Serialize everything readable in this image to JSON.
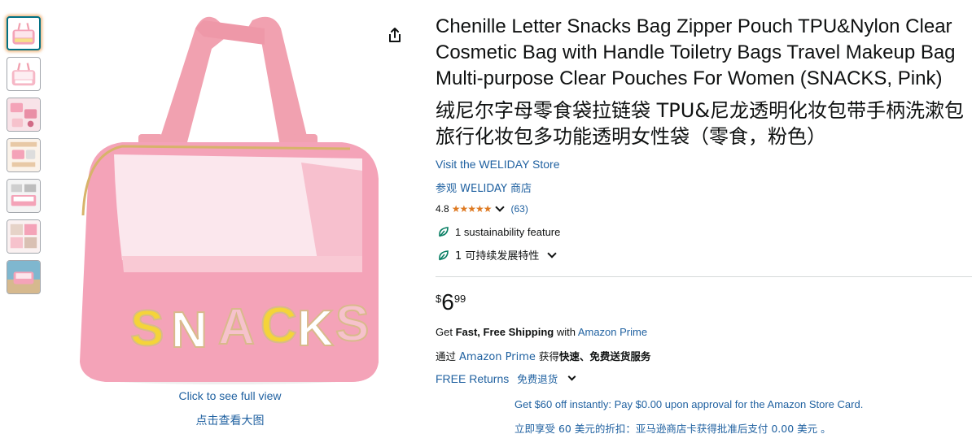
{
  "thumbnails": [
    {
      "name": "thumb-1",
      "selected": true
    },
    {
      "name": "thumb-2",
      "selected": false
    },
    {
      "name": "thumb-3",
      "selected": false
    },
    {
      "name": "thumb-4",
      "selected": false
    },
    {
      "name": "thumb-5",
      "selected": false
    },
    {
      "name": "thumb-6",
      "selected": false
    },
    {
      "name": "thumb-7",
      "selected": false
    }
  ],
  "image": {
    "bag_text": "SNACKS",
    "caption_en": "Click to see full view",
    "caption_zh": "点击查看大图"
  },
  "product": {
    "title_en": "Chenille Letter Snacks Bag Zipper Pouch TPU&Nylon Clear Cosmetic Bag with Handle Toiletry Bags Travel Makeup Bag Multi-purpose Clear Pouches For Women (SNACKS, Pink)",
    "title_zh": "绒尼尔字母零食袋拉链袋 TPU&尼龙透明化妆包带手柄洗漱包旅行化妆包多功能透明女性袋（零食，粉色）",
    "store_en": "Visit the WELIDAY Store",
    "store_zh": "参观 WELIDAY 商店",
    "rating": "4.8",
    "rating_stars": "★★★★★",
    "rating_count": "(63)",
    "sustainability_en": "1 sustainability feature",
    "sustainability_zh": "1 可持续发展特性"
  },
  "price": {
    "symbol": "$",
    "whole": "6",
    "fraction": "99"
  },
  "shipping": {
    "en_prefix": "Get ",
    "en_bold": "Fast, Free Shipping",
    "en_mid": " with ",
    "en_link": "Amazon Prime",
    "zh_prefix": "通过 ",
    "zh_link": "Amazon Prime",
    "zh_mid": " 获得",
    "zh_bold": "快速、免费送货服务",
    "returns_en": "FREE Returns",
    "returns_zh": "免费退货"
  },
  "promo": {
    "en": "Get $60 off instantly: Pay $0.00 upon approval for the Amazon Store Card.",
    "zh": "立即享受 60 美元的折扣：亚马逊商店卡获得批准后支付 0.00 美元 。"
  },
  "colors": {
    "link": "#2162a1",
    "star": "#de7921",
    "bag_pink": "#f4a3b8",
    "handle_pink": "#f1a1b0",
    "letter_yellow": "#f4d43a",
    "letter_white": "#ffffff",
    "letter_pink": "#f6c2cc"
  }
}
